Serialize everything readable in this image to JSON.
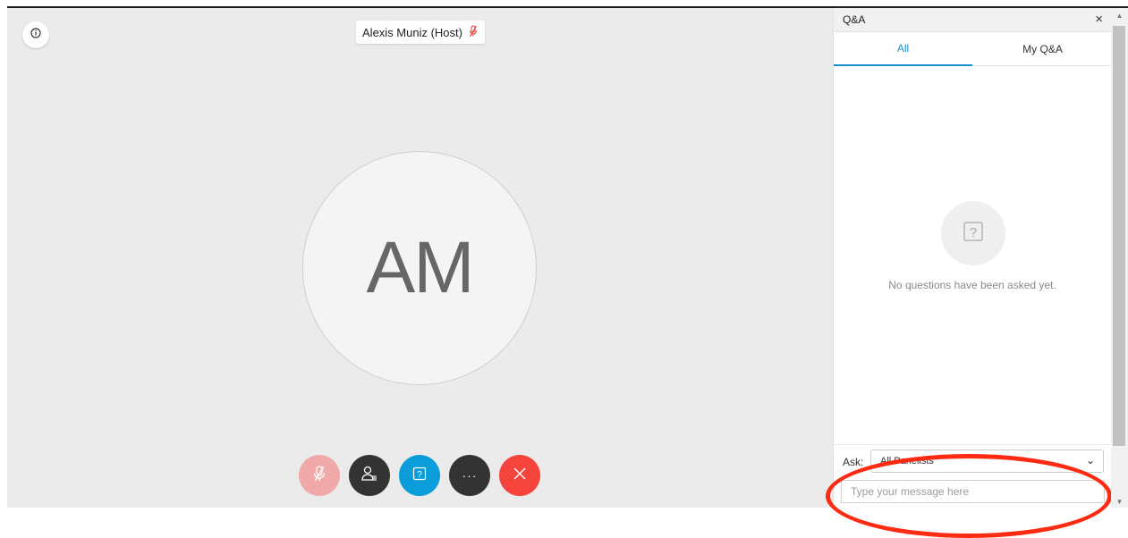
{
  "meeting": {
    "speaker_name": "Alexis Muniz (Host)",
    "avatar_initials": "AM",
    "info_icon": "info-icon",
    "speaker_muted_icon": "microphone-muted-icon"
  },
  "controls": [
    {
      "name": "mute-button",
      "icon": "microphone-muted-icon",
      "color": "#f0a8a8"
    },
    {
      "name": "participants-button",
      "icon": "participants-icon",
      "color": "#333333"
    },
    {
      "name": "qa-button",
      "icon": "question-box-icon",
      "color": "#0a9dd9"
    },
    {
      "name": "more-options-button",
      "icon": "ellipsis-icon",
      "label": "···",
      "color": "#333333"
    },
    {
      "name": "leave-meeting-button",
      "icon": "close-icon",
      "color": "#f4443c"
    }
  ],
  "qa_panel": {
    "title": "Q&A",
    "close_label": "×",
    "tabs": [
      {
        "label": "All",
        "active": true
      },
      {
        "label": "My Q&A",
        "active": false
      }
    ],
    "empty_state": {
      "icon": "question-box-icon",
      "text": "No questions have been asked yet."
    },
    "ask": {
      "label": "Ask:",
      "selected": "All Panelists",
      "chevron": "⌄"
    },
    "message_input": {
      "placeholder": "Type your message here",
      "value": ""
    }
  },
  "colors": {
    "accent": "#1a8ed3",
    "stage_bg": "#ebebeb",
    "annotation": "#ff2a12",
    "leave": "#f4443c"
  },
  "scrollbar": {
    "up": "▲",
    "down": "▼"
  }
}
